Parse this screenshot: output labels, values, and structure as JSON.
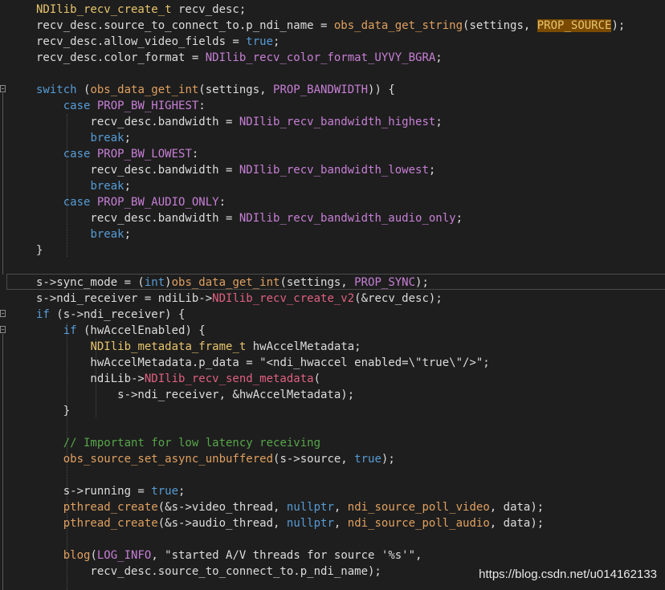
{
  "editor": {
    "theme_colors": {
      "background": "#1e1e1e",
      "keyword": "#569cd6",
      "type": "#e8c56d",
      "function": "#e0a060",
      "macro": "#c77fd6",
      "string": "#d69d85",
      "comment": "#57a64a",
      "highlight": "#7a4a00"
    },
    "lines": [
      [
        {
          "c": "t-type",
          "t": "NDIlib_recv_create_t"
        },
        {
          "c": "t-plain",
          "t": " recv_desc;"
        }
      ],
      [
        {
          "c": "t-plain",
          "t": "recv_desc.source_to_connect_to.p_ndi_name = "
        },
        {
          "c": "t-fn",
          "t": "obs_data_get_string"
        },
        {
          "c": "t-plain",
          "t": "(settings, "
        },
        {
          "c": "t-highlight",
          "t": "PROP_SOURCE"
        },
        {
          "c": "t-plain",
          "t": ");"
        }
      ],
      [
        {
          "c": "t-plain",
          "t": "recv_desc.allow_video_fields = "
        },
        {
          "c": "t-kw",
          "t": "true"
        },
        {
          "c": "t-plain",
          "t": ";"
        }
      ],
      [
        {
          "c": "t-plain",
          "t": "recv_desc.color_format = "
        },
        {
          "c": "t-const",
          "t": "NDIlib_recv_color_format_UYVY_BGRA"
        },
        {
          "c": "t-plain",
          "t": ";"
        }
      ],
      [],
      [
        {
          "c": "t-kw",
          "t": "switch"
        },
        {
          "c": "t-plain",
          "t": " ("
        },
        {
          "c": "t-fn",
          "t": "obs_data_get_int"
        },
        {
          "c": "t-plain",
          "t": "(settings, "
        },
        {
          "c": "t-macro",
          "t": "PROP_BANDWIDTH"
        },
        {
          "c": "t-plain",
          "t": ")) {"
        }
      ],
      [
        {
          "c": "t-plain",
          "t": "    "
        },
        {
          "c": "t-kw",
          "t": "case"
        },
        {
          "c": "t-plain",
          "t": " "
        },
        {
          "c": "t-macro",
          "t": "PROP_BW_HIGHEST"
        },
        {
          "c": "t-plain",
          "t": ":"
        }
      ],
      [
        {
          "c": "t-plain",
          "t": "        recv_desc.bandwidth = "
        },
        {
          "c": "t-const",
          "t": "NDIlib_recv_bandwidth_highest"
        },
        {
          "c": "t-plain",
          "t": ";"
        }
      ],
      [
        {
          "c": "t-plain",
          "t": "        "
        },
        {
          "c": "t-kw",
          "t": "break"
        },
        {
          "c": "t-plain",
          "t": ";"
        }
      ],
      [
        {
          "c": "t-plain",
          "t": "    "
        },
        {
          "c": "t-kw",
          "t": "case"
        },
        {
          "c": "t-plain",
          "t": " "
        },
        {
          "c": "t-macro",
          "t": "PROP_BW_LOWEST"
        },
        {
          "c": "t-plain",
          "t": ":"
        }
      ],
      [
        {
          "c": "t-plain",
          "t": "        recv_desc.bandwidth = "
        },
        {
          "c": "t-const",
          "t": "NDIlib_recv_bandwidth_lowest"
        },
        {
          "c": "t-plain",
          "t": ";"
        }
      ],
      [
        {
          "c": "t-plain",
          "t": "        "
        },
        {
          "c": "t-kw",
          "t": "break"
        },
        {
          "c": "t-plain",
          "t": ";"
        }
      ],
      [
        {
          "c": "t-plain",
          "t": "    "
        },
        {
          "c": "t-kw",
          "t": "case"
        },
        {
          "c": "t-plain",
          "t": " "
        },
        {
          "c": "t-macro",
          "t": "PROP_BW_AUDIO_ONLY"
        },
        {
          "c": "t-plain",
          "t": ":"
        }
      ],
      [
        {
          "c": "t-plain",
          "t": "        recv_desc.bandwidth = "
        },
        {
          "c": "t-const",
          "t": "NDIlib_recv_bandwidth_audio_only"
        },
        {
          "c": "t-plain",
          "t": ";"
        }
      ],
      [
        {
          "c": "t-plain",
          "t": "        "
        },
        {
          "c": "t-kw",
          "t": "break"
        },
        {
          "c": "t-plain",
          "t": ";"
        }
      ],
      [
        {
          "c": "t-plain",
          "t": "}"
        }
      ],
      [],
      [
        {
          "c": "t-plain",
          "t": "s->sync_mode = ("
        },
        {
          "c": "t-kw",
          "t": "int"
        },
        {
          "c": "t-plain",
          "t": ")"
        },
        {
          "c": "t-fn",
          "t": "obs_data_get_int"
        },
        {
          "c": "t-plain",
          "t": "(settings, "
        },
        {
          "c": "t-macro",
          "t": "PROP_SYNC"
        },
        {
          "c": "t-plain",
          "t": ");"
        }
      ],
      [
        {
          "c": "t-plain",
          "t": "s->ndi_receiver = ndiLib->"
        },
        {
          "c": "t-func2",
          "t": "NDIlib_recv_create_v2"
        },
        {
          "c": "t-plain",
          "t": "(&recv_desc);"
        }
      ],
      [
        {
          "c": "t-kw",
          "t": "if"
        },
        {
          "c": "t-plain",
          "t": " (s->ndi_receiver) {"
        }
      ],
      [
        {
          "c": "t-plain",
          "t": "    "
        },
        {
          "c": "t-kw",
          "t": "if"
        },
        {
          "c": "t-plain",
          "t": " (hwAccelEnabled) {"
        }
      ],
      [
        {
          "c": "t-plain",
          "t": "        "
        },
        {
          "c": "t-type",
          "t": "NDIlib_metadata_frame_t"
        },
        {
          "c": "t-plain",
          "t": " hwAccelMetadata;"
        }
      ],
      [
        {
          "c": "t-plain",
          "t": "        hwAccelMetadata.p_data = "
        },
        {
          "c": "t-plain",
          "t": "\"<ndi_hwaccel enabled=\\\"true\\\"/>\";"
        }
      ],
      [
        {
          "c": "t-plain",
          "t": "        ndiLib->"
        },
        {
          "c": "t-func2",
          "t": "NDIlib_recv_send_metadata"
        },
        {
          "c": "t-plain",
          "t": "("
        }
      ],
      [
        {
          "c": "t-plain",
          "t": "            s->ndi_receiver, &hwAccelMetadata);"
        }
      ],
      [
        {
          "c": "t-plain",
          "t": "    }"
        }
      ],
      [],
      [
        {
          "c": "t-plain",
          "t": "    "
        },
        {
          "c": "t-comment",
          "t": "// Important for low latency receiving"
        }
      ],
      [
        {
          "c": "t-plain",
          "t": "    "
        },
        {
          "c": "t-fn",
          "t": "obs_source_set_async_unbuffered"
        },
        {
          "c": "t-plain",
          "t": "(s->source, "
        },
        {
          "c": "t-kw",
          "t": "true"
        },
        {
          "c": "t-plain",
          "t": ");"
        }
      ],
      [],
      [
        {
          "c": "t-plain",
          "t": "    s->running = "
        },
        {
          "c": "t-kw",
          "t": "true"
        },
        {
          "c": "t-plain",
          "t": ";"
        }
      ],
      [
        {
          "c": "t-plain",
          "t": "    "
        },
        {
          "c": "t-fn",
          "t": "pthread_create"
        },
        {
          "c": "t-plain",
          "t": "(&s->video_thread, "
        },
        {
          "c": "t-kw",
          "t": "nullptr"
        },
        {
          "c": "t-plain",
          "t": ", "
        },
        {
          "c": "t-fn",
          "t": "ndi_source_poll_video"
        },
        {
          "c": "t-plain",
          "t": ", data);"
        }
      ],
      [
        {
          "c": "t-plain",
          "t": "    "
        },
        {
          "c": "t-fn",
          "t": "pthread_create"
        },
        {
          "c": "t-plain",
          "t": "(&s->audio_thread, "
        },
        {
          "c": "t-kw",
          "t": "nullptr"
        },
        {
          "c": "t-plain",
          "t": ", "
        },
        {
          "c": "t-fn",
          "t": "ndi_source_poll_audio"
        },
        {
          "c": "t-plain",
          "t": ", data);"
        }
      ],
      [],
      [
        {
          "c": "t-plain",
          "t": "    "
        },
        {
          "c": "t-fn",
          "t": "blog"
        },
        {
          "c": "t-plain",
          "t": "("
        },
        {
          "c": "t-macro",
          "t": "LOG_INFO"
        },
        {
          "c": "t-plain",
          "t": ", \"started A/V threads for source '%s'\","
        }
      ],
      [
        {
          "c": "t-plain",
          "t": "        recv_desc.source_to_connect_to.p_ndi_name);"
        }
      ]
    ]
  },
  "watermark": "https://blog.csdn.net/u014162133"
}
